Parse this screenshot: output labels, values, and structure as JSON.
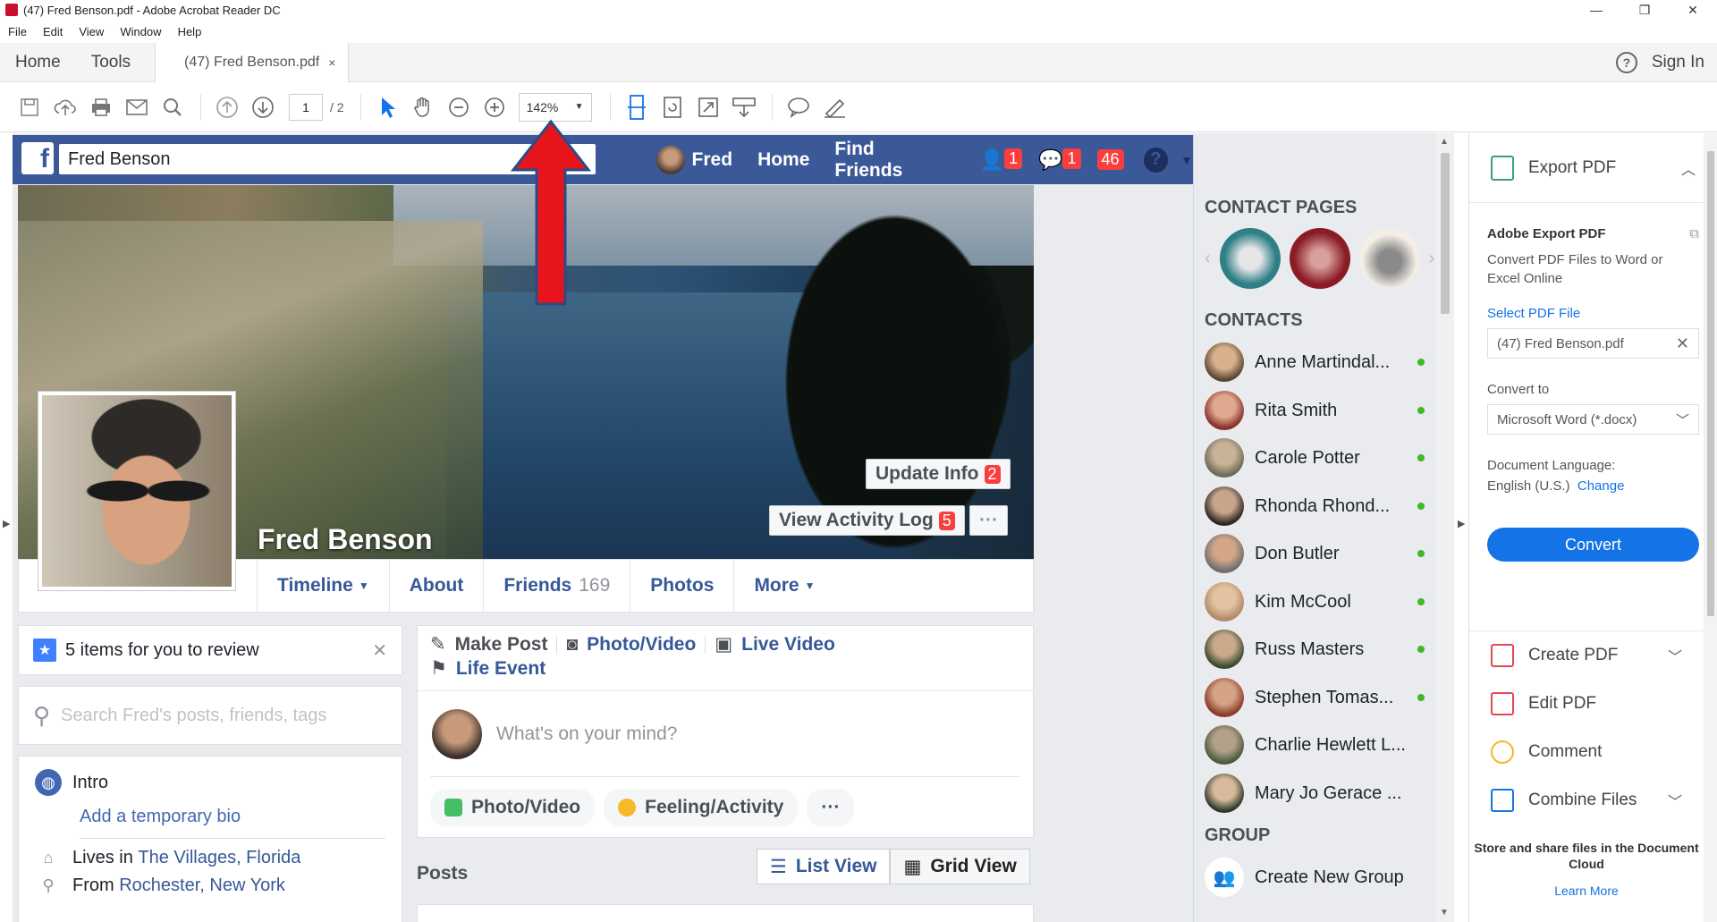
{
  "window": {
    "title": "(47) Fred Benson.pdf - Adobe Acrobat Reader DC",
    "minimize": "—",
    "restore": "❐",
    "close": "✕"
  },
  "menu": [
    "File",
    "Edit",
    "View",
    "Window",
    "Help"
  ],
  "tabs": {
    "home": "Home",
    "tools": "Tools",
    "document": "(47) Fred Benson.pdf",
    "close": "×",
    "help": "?",
    "signin": "Sign In"
  },
  "toolbar": {
    "page_current": "1",
    "page_total": "/ 2",
    "zoom": "142%"
  },
  "facebook": {
    "search_value": "Fred Benson",
    "nav": {
      "user": "Fred",
      "home": "Home",
      "find_friends": "Find Friends"
    },
    "badges": {
      "friend_requests": "1",
      "messages": "1",
      "notifications": "46"
    },
    "cover_name": "Fred Benson",
    "update_info": "Update Info",
    "update_info_badge": "2",
    "activity_log": "View Activity Log",
    "activity_log_badge": "5",
    "more_dots": "···",
    "profile_tabs": {
      "timeline": "Timeline",
      "about": "About",
      "friends": "Friends",
      "friends_count": "169",
      "photos": "Photos",
      "more": "More"
    },
    "review": "5 items for you to review",
    "search_placeholder": "Search Fred's posts, friends, tags",
    "intro": {
      "title": "Intro",
      "bio": "Add a temporary bio",
      "lives_prefix": "Lives in",
      "lives_link": "The Villages, Florida",
      "from_prefix": "From",
      "from_link": "Rochester, New York"
    },
    "composer": {
      "make_post": "Make Post",
      "photo_video": "Photo/Video",
      "live_video": "Live Video",
      "life_event": "Life Event",
      "placeholder": "What's on your mind?",
      "pill_photo": "Photo/Video",
      "pill_feeling": "Feeling/Activity",
      "pill_more": "···"
    },
    "posts": {
      "label": "Posts",
      "list_view": "List View",
      "grid_view": "Grid View"
    },
    "sidebar": {
      "contact_pages_header": "CONTACT PAGES",
      "contacts_header": "CONTACTS",
      "contacts": [
        "Anne Martindal...",
        "Rita Smith",
        "Carole Potter",
        "Rhonda Rhond...",
        "Don Butler",
        "Kim McCool",
        "Russ Masters",
        "Stephen Tomas...",
        "Charlie Hewlett L...",
        "Mary Jo Gerace ..."
      ],
      "group_header": "GROUP",
      "create_group": "Create New Group"
    }
  },
  "pane": {
    "export_pdf": "Export PDF",
    "adobe_export": "Adobe Export PDF",
    "description": "Convert PDF Files to Word or Excel Online",
    "select_file": "Select PDF File",
    "file_name": "(47) Fred Benson.pdf",
    "convert_to": "Convert to",
    "format": "Microsoft Word (*.docx)",
    "doc_language_label": "Document Language:",
    "doc_language": "English (U.S.)",
    "change": "Change",
    "convert": "Convert",
    "tools": [
      "Create PDF",
      "Edit PDF",
      "Comment",
      "Combine Files"
    ],
    "cloud": "Store and share files in the Document Cloud",
    "learn_more": "Learn More"
  },
  "colors": {
    "fb_blue": "#3b5998",
    "acrobat_blue": "#1473e6",
    "annotation_red": "#e8141b"
  }
}
